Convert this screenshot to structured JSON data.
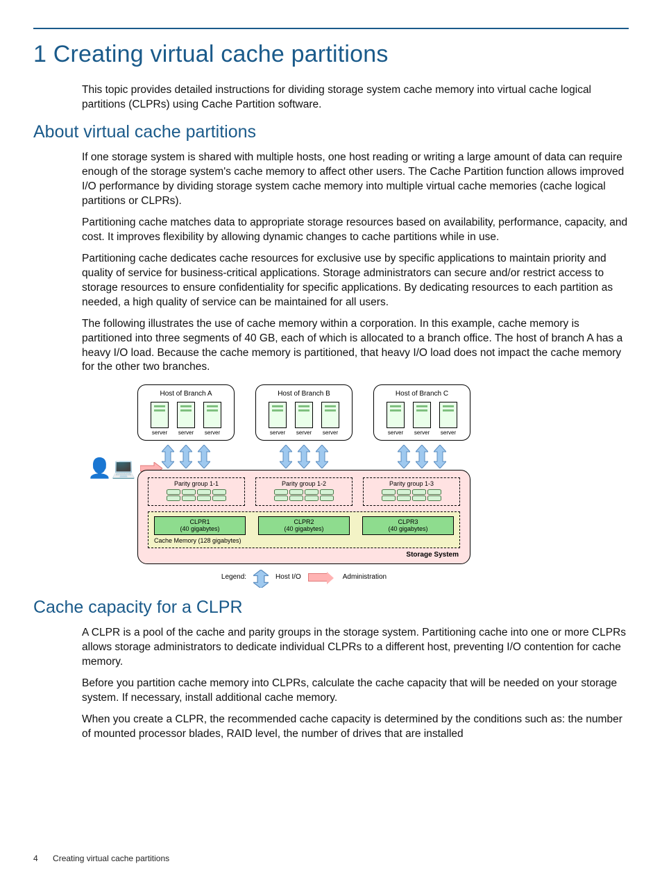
{
  "chapter": {
    "number": "1",
    "title": "Creating virtual cache partitions"
  },
  "intro": "This topic provides detailed instructions for dividing storage system cache memory into virtual cache logical partitions (CLPRs) using Cache Partition software.",
  "sections": {
    "about": {
      "heading": "About virtual cache partitions",
      "p1": "If one storage system is shared with multiple hosts, one host reading or writing a large amount of data can require enough of the storage system's cache memory to affect other users. The Cache Partition function allows improved I/O performance by dividing storage system cache memory into multiple virtual cache memories (cache logical partitions or CLPRs).",
      "p2": "Partitioning cache matches data to appropriate storage resources based on availability, performance, capacity, and cost. It improves flexibility by allowing dynamic changes to cache partitions while in use.",
      "p3": "Partitioning cache dedicates cache resources for exclusive use by specific applications to maintain priority and quality of service for business-critical applications. Storage administrators can secure and/or restrict access to storage resources to ensure confidentiality for specific applications. By dedicating resources to each partition as needed, a high quality of service can be maintained for all users.",
      "p4": "The following illustrates the use of cache memory within a corporation. In this example, cache memory is partitioned into three segments of 40 GB, each of which is allocated to a branch office. The host of branch A has a heavy I/O load. Because the cache memory is partitioned, that heavy I/O load does not impact the cache memory for the other two branches."
    },
    "capacity": {
      "heading": "Cache capacity for a CLPR",
      "p1": "A CLPR is a pool of the cache and parity groups in the storage system. Partitioning cache into one or more CLPRs allows storage administrators to dedicate individual CLPRs to a different host, preventing I/O contention for cache memory.",
      "p2": "Before you partition cache memory into CLPRs, calculate the cache capacity that will be needed on your storage system. If necessary, install additional cache memory.",
      "p3": "When you create a CLPR, the recommended cache capacity is determined by the conditions such as: the number of mounted processor blades, RAID level, the number of drives that are installed"
    }
  },
  "diagram": {
    "hosts": [
      {
        "label": "Host of Branch A"
      },
      {
        "label": "Host of Branch B"
      },
      {
        "label": "Host of Branch C"
      }
    ],
    "server_label": "server",
    "parity_groups": [
      {
        "label": "Parity group 1-1"
      },
      {
        "label": "Parity group 1-2"
      },
      {
        "label": "Parity group 1-3"
      }
    ],
    "clprs": [
      {
        "name": "CLPR1",
        "size": "(40 gigabytes)"
      },
      {
        "name": "CLPR2",
        "size": "(40 gigabytes)"
      },
      {
        "name": "CLPR3",
        "size": "(40 gigabytes)"
      }
    ],
    "cache_memory_label": "Cache Memory (128 gigabytes)",
    "storage_system_label": "Storage System",
    "legend": {
      "title": "Legend:",
      "host_io": "Host I/O",
      "administration": "Administration"
    }
  },
  "footer": {
    "page_number": "4",
    "running_title": "Creating virtual cache partitions"
  }
}
